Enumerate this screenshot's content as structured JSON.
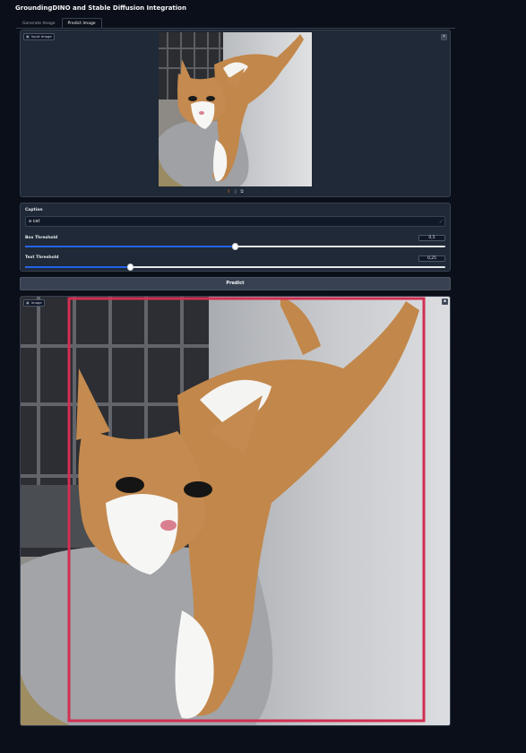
{
  "app": {
    "title": "GroundingDINO and Stable Diffusion Integration"
  },
  "tabs": [
    {
      "label": "Generate Image",
      "active": false
    },
    {
      "label": "Predict Image",
      "active": true
    }
  ],
  "input_image": {
    "label": "Input Image"
  },
  "caption": {
    "label": "Caption",
    "value": "a cat"
  },
  "box_threshold": {
    "label": "Box Threshold",
    "value": "0,5",
    "fraction": 0.5
  },
  "text_threshold": {
    "label": "Text Threshold",
    "value": "0,25",
    "fraction": 0.25
  },
  "predict_button": {
    "label": "Predict"
  },
  "output_image": {
    "label": "Image"
  },
  "colors": {
    "accent": "#2563eb",
    "box": "#d12f52",
    "background": "#0b0f19",
    "panel": "#1f2937"
  }
}
